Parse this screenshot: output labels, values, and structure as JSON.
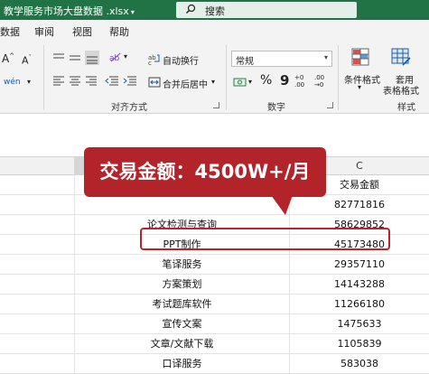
{
  "titlebar": {
    "filename": "教学服务市场大盘数据 .xlsx",
    "search_label": "搜索"
  },
  "menu": {
    "tabs": [
      "数据",
      "审阅",
      "视图",
      "帮助"
    ]
  },
  "ribbon": {
    "wrap_text": "自动换行",
    "merge_center": "合并后居中",
    "alignment_group": "对齐方式",
    "number_format_value": "常规",
    "number_group": "数字",
    "conditional_format": "条件格式",
    "table_format_line1": "套用",
    "table_format_line2": "表格格式",
    "styles_group": "样式",
    "font_grow": "A",
    "font_shrink": "A",
    "percent": "%",
    "comma": "9",
    "inc_decimal": "+0 .00",
    "dec_decimal": ".00 →0"
  },
  "sheet": {
    "column_c_header": "C",
    "rows": [
      {
        "b": "",
        "c": "交易金额"
      },
      {
        "b": "",
        "c": "82771816"
      },
      {
        "b": "论文检测与查询",
        "c": "58629852"
      },
      {
        "b": "PPT制作",
        "c": "45173480"
      },
      {
        "b": "笔译服务",
        "c": "29357110"
      },
      {
        "b": "方案策划",
        "c": "14143288"
      },
      {
        "b": "考试题库软件",
        "c": "11266180"
      },
      {
        "b": "宣传文案",
        "c": "1475633"
      },
      {
        "b": "文章/文献下载",
        "c": "1105839"
      },
      {
        "b": "口译服务",
        "c": "583038"
      }
    ]
  },
  "callout": {
    "text": "交易金额：4500W+/月",
    "color": "#b3232a"
  },
  "colors": {
    "brand": "#217346",
    "highlight_border": "#c0202a"
  }
}
